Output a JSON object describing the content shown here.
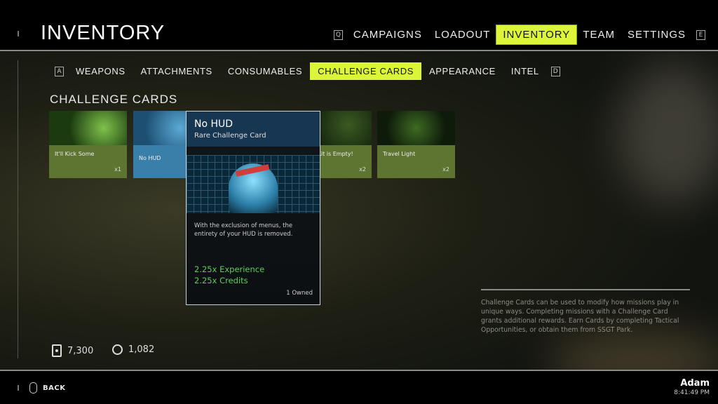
{
  "header": {
    "title": "INVENTORY",
    "key_left": "Q",
    "key_right": "E",
    "tabs": [
      {
        "label": "CAMPAIGNS"
      },
      {
        "label": "LOADOUT"
      },
      {
        "label": "INVENTORY",
        "active": true
      },
      {
        "label": "TEAM"
      },
      {
        "label": "SETTINGS"
      }
    ]
  },
  "subnav": {
    "key_left": "A",
    "key_right": "D",
    "tabs": [
      {
        "label": "WEAPONS"
      },
      {
        "label": "ATTACHMENTS"
      },
      {
        "label": "CONSUMABLES"
      },
      {
        "label": "CHALLENGE CARDS",
        "active": true
      },
      {
        "label": "APPEARANCE"
      },
      {
        "label": "INTEL"
      }
    ]
  },
  "section_title": "CHALLENGE CARDS",
  "cards": [
    {
      "name": "It'll Kick Some",
      "count": "x1"
    },
    {
      "name": "No HUD",
      "count": ""
    },
    {
      "name": "d Kit is Empty!",
      "count": "x2"
    },
    {
      "name": "Travel Light",
      "count": "x2"
    }
  ],
  "detail": {
    "title": "No HUD",
    "subtitle": "Rare Challenge Card",
    "description": "With the exclusion of menus, the entirety of your HUD is removed.",
    "rewards": [
      "2.25x Experience",
      "2.25x Credits"
    ],
    "owned": "1 Owned"
  },
  "info_text": "Challenge Cards can be used to modify how missions play in unique ways. Completing missions with a Challenge Card grants additional rewards. Earn Cards by completing Tactical Opportunities, or obtain them from SSGT Park.",
  "currency": {
    "cards": "7,300",
    "credits": "1,082"
  },
  "footer": {
    "back": "BACK",
    "user": "Adam",
    "time": "8:41:49 PM"
  },
  "colors": {
    "accent": "#ddf539",
    "card_green": "#5d7530",
    "card_blue": "#2f6f9a",
    "popup_header": "#173652",
    "reward": "#5fcd5c"
  }
}
